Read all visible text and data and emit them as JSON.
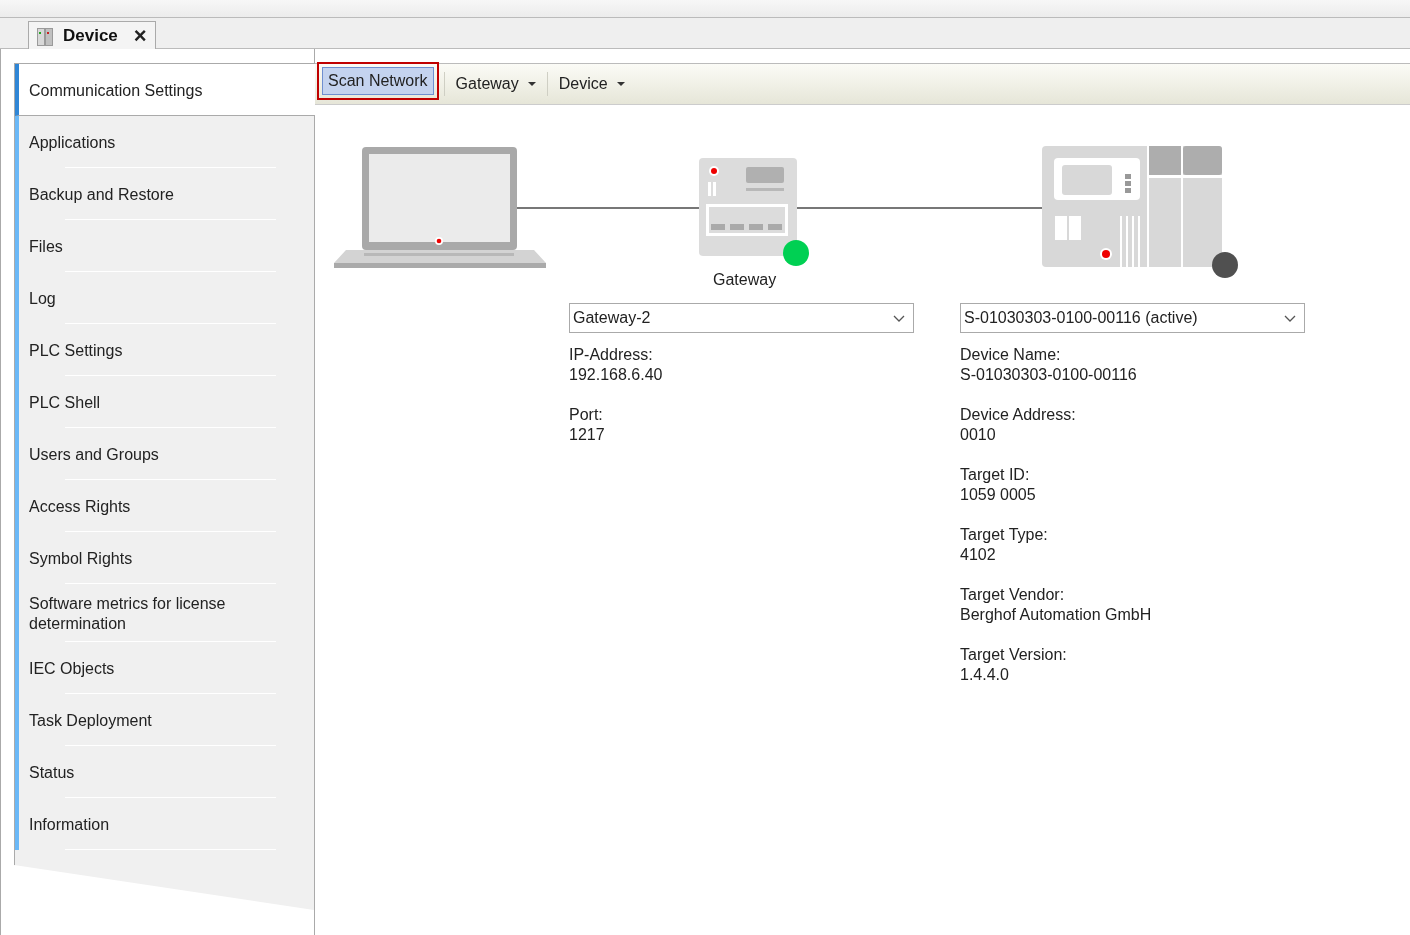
{
  "editor_tab": {
    "title": "Device",
    "close": "×"
  },
  "sidebar": {
    "items": [
      {
        "label": "Communication Settings",
        "selected": true
      },
      {
        "label": "Applications",
        "selected": false
      },
      {
        "label": "Backup and Restore",
        "selected": false
      },
      {
        "label": "Files",
        "selected": false
      },
      {
        "label": "Log",
        "selected": false
      },
      {
        "label": "PLC Settings",
        "selected": false
      },
      {
        "label": "PLC Shell",
        "selected": false
      },
      {
        "label": "Users and Groups",
        "selected": false
      },
      {
        "label": "Access Rights",
        "selected": false
      },
      {
        "label": "Symbol Rights",
        "selected": false
      },
      {
        "label": "Software metrics for license determination",
        "selected": false
      },
      {
        "label": "IEC Objects",
        "selected": false
      },
      {
        "label": "Task Deployment",
        "selected": false
      },
      {
        "label": "Status",
        "selected": false
      },
      {
        "label": "Information",
        "selected": false
      }
    ]
  },
  "toolbar": [
    {
      "label": "Scan Network",
      "kind": "button",
      "highlighted": true
    },
    {
      "label": "Gateway",
      "kind": "menu",
      "highlighted": false
    },
    {
      "label": "Device",
      "kind": "menu",
      "highlighted": false
    }
  ],
  "diagram": {
    "gateway": {
      "label": "Gateway",
      "color": "#00d053"
    },
    "device": {
      "color": "#505050"
    }
  },
  "gateway": {
    "dropdown": "Gateway-2",
    "fields": [
      {
        "label": "IP-Address:",
        "value": "192.168.6.40"
      },
      {
        "label": "Port:",
        "value": "1217"
      }
    ]
  },
  "device": {
    "dropdown": "S-01030303-0100-00116 (active)",
    "fields": [
      {
        "label": "Device Name:",
        "value": "S-01030303-0100-00116"
      },
      {
        "label": "Device Address:",
        "value": "0010"
      },
      {
        "label": "Target ID:",
        "value": "1059  0005"
      },
      {
        "label": "Target Type:",
        "value": "4102"
      },
      {
        "label": "Target Vendor:",
        "value": "Berghof Automation GmbH"
      },
      {
        "label": "Target Version:",
        "value": "1.4.4.0"
      }
    ]
  }
}
